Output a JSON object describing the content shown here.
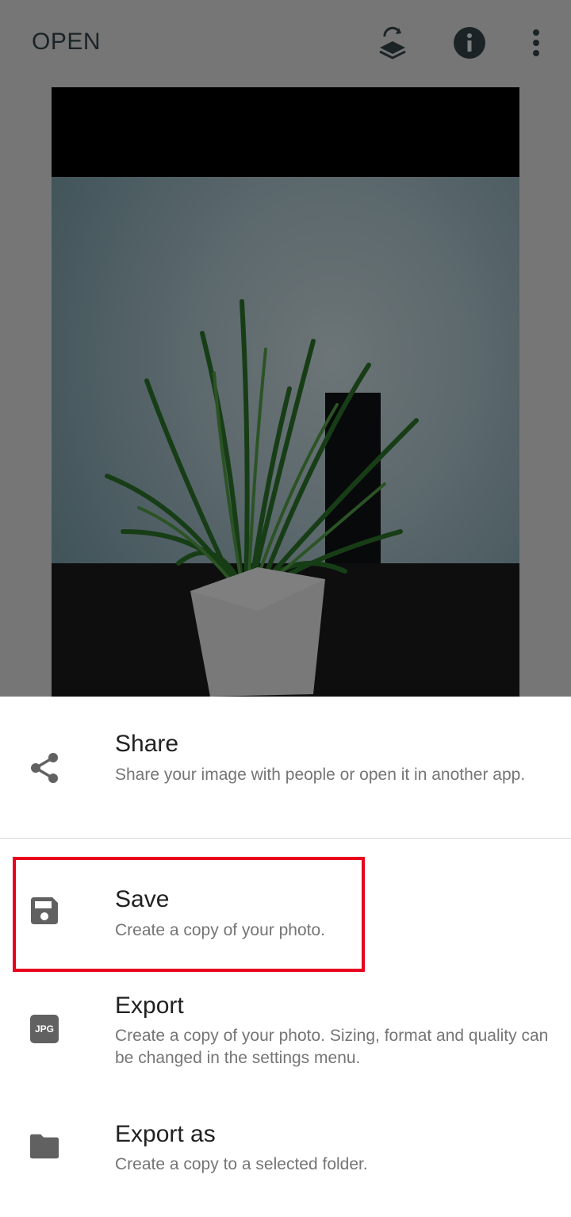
{
  "toolbar": {
    "open_label": "OPEN",
    "icons": [
      "layers-icon",
      "info-icon",
      "more-vert-icon"
    ]
  },
  "photo": {
    "subject": "potted plant"
  },
  "sheet": {
    "items": [
      {
        "icon": "share-icon",
        "title": "Share",
        "subtitle": "Share your image with people or open it in another app."
      },
      {
        "icon": "save-icon",
        "title": "Save",
        "subtitle": "Create a copy of your photo."
      },
      {
        "icon": "jpg-icon",
        "icon_text": "JPG",
        "title": "Export",
        "subtitle": "Create a copy of your photo. Sizing, format and quality can be changed in the settings menu."
      },
      {
        "icon": "folder-icon",
        "title": "Export as",
        "subtitle": "Create a copy to a selected folder."
      }
    ],
    "highlight_color": "#e8001c"
  },
  "colors": {
    "toolbar_text": "#37474f",
    "icon_gray": "#616161",
    "title_text": "#212121",
    "subtitle_text": "#757575"
  }
}
